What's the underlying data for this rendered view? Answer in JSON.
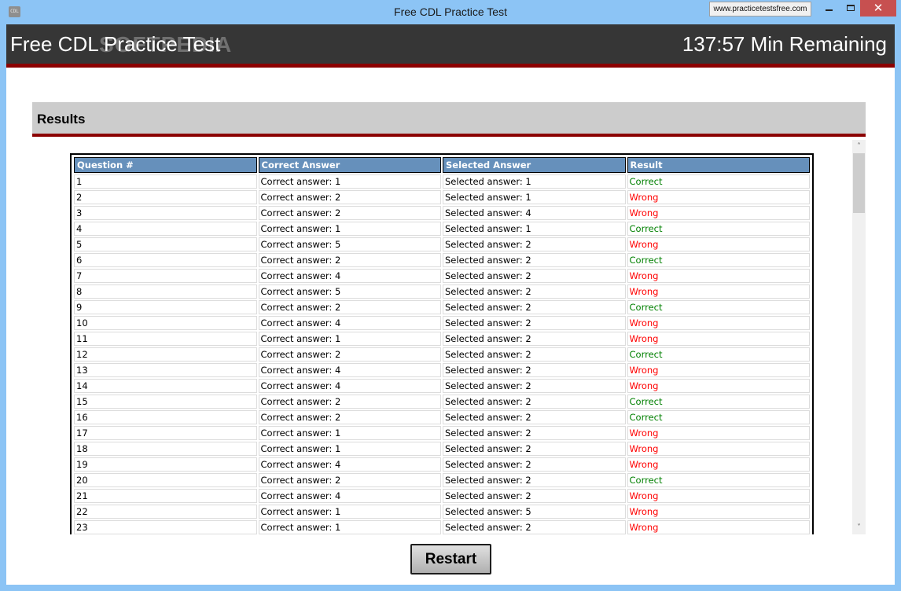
{
  "window": {
    "title": "Free CDL Practice Test",
    "icon_label": "CDL",
    "url_badge": "www.practicetestsfree.com",
    "controls": {
      "minimize": "minimize",
      "maximize": "maximize",
      "close": "✕"
    }
  },
  "header": {
    "app_title": "Free CDL Practice Test",
    "watermark": "SOFTPEDIA",
    "timer": "137:57 Min Remaining"
  },
  "results": {
    "title": "Results",
    "columns": [
      "Question #",
      "Correct Answer",
      "Selected Answer",
      "Result"
    ],
    "rows": [
      {
        "q": "1",
        "correct": "Correct answer: 1",
        "selected": "Selected answer: 1",
        "result": "Correct"
      },
      {
        "q": "2",
        "correct": "Correct answer: 2",
        "selected": "Selected answer: 1",
        "result": "Wrong"
      },
      {
        "q": "3",
        "correct": "Correct answer: 2",
        "selected": "Selected answer: 4",
        "result": "Wrong"
      },
      {
        "q": "4",
        "correct": "Correct answer: 1",
        "selected": "Selected answer: 1",
        "result": "Correct"
      },
      {
        "q": "5",
        "correct": "Correct answer: 5",
        "selected": "Selected answer: 2",
        "result": "Wrong"
      },
      {
        "q": "6",
        "correct": "Correct answer: 2",
        "selected": "Selected answer: 2",
        "result": "Correct"
      },
      {
        "q": "7",
        "correct": "Correct answer: 4",
        "selected": "Selected answer: 2",
        "result": "Wrong"
      },
      {
        "q": "8",
        "correct": "Correct answer: 5",
        "selected": "Selected answer: 2",
        "result": "Wrong"
      },
      {
        "q": "9",
        "correct": "Correct answer: 2",
        "selected": "Selected answer: 2",
        "result": "Correct"
      },
      {
        "q": "10",
        "correct": "Correct answer: 4",
        "selected": "Selected answer: 2",
        "result": "Wrong"
      },
      {
        "q": "11",
        "correct": "Correct answer: 1",
        "selected": "Selected answer: 2",
        "result": "Wrong"
      },
      {
        "q": "12",
        "correct": "Correct answer: 2",
        "selected": "Selected answer: 2",
        "result": "Correct"
      },
      {
        "q": "13",
        "correct": "Correct answer: 4",
        "selected": "Selected answer: 2",
        "result": "Wrong"
      },
      {
        "q": "14",
        "correct": "Correct answer: 4",
        "selected": "Selected answer: 2",
        "result": "Wrong"
      },
      {
        "q": "15",
        "correct": "Correct answer: 2",
        "selected": "Selected answer: 2",
        "result": "Correct"
      },
      {
        "q": "16",
        "correct": "Correct answer: 2",
        "selected": "Selected answer: 2",
        "result": "Correct"
      },
      {
        "q": "17",
        "correct": "Correct answer: 1",
        "selected": "Selected answer: 2",
        "result": "Wrong"
      },
      {
        "q": "18",
        "correct": "Correct answer: 1",
        "selected": "Selected answer: 2",
        "result": "Wrong"
      },
      {
        "q": "19",
        "correct": "Correct answer: 4",
        "selected": "Selected answer: 2",
        "result": "Wrong"
      },
      {
        "q": "20",
        "correct": "Correct answer: 2",
        "selected": "Selected answer: 2",
        "result": "Correct"
      },
      {
        "q": "21",
        "correct": "Correct answer: 4",
        "selected": "Selected answer: 2",
        "result": "Wrong"
      },
      {
        "q": "22",
        "correct": "Correct answer: 1",
        "selected": "Selected answer: 5",
        "result": "Wrong"
      },
      {
        "q": "23",
        "correct": "Correct answer: 1",
        "selected": "Selected answer: 2",
        "result": "Wrong"
      }
    ]
  },
  "scrollbar": {
    "up_icon": "˄",
    "down_icon": "˅"
  },
  "footer": {
    "restart_label": "Restart"
  },
  "colors": {
    "header_bg": "#363636",
    "accent_red": "#8b0000",
    "table_header": "#6690bb",
    "result_correct": "#008000",
    "result_wrong": "#ff0000"
  }
}
